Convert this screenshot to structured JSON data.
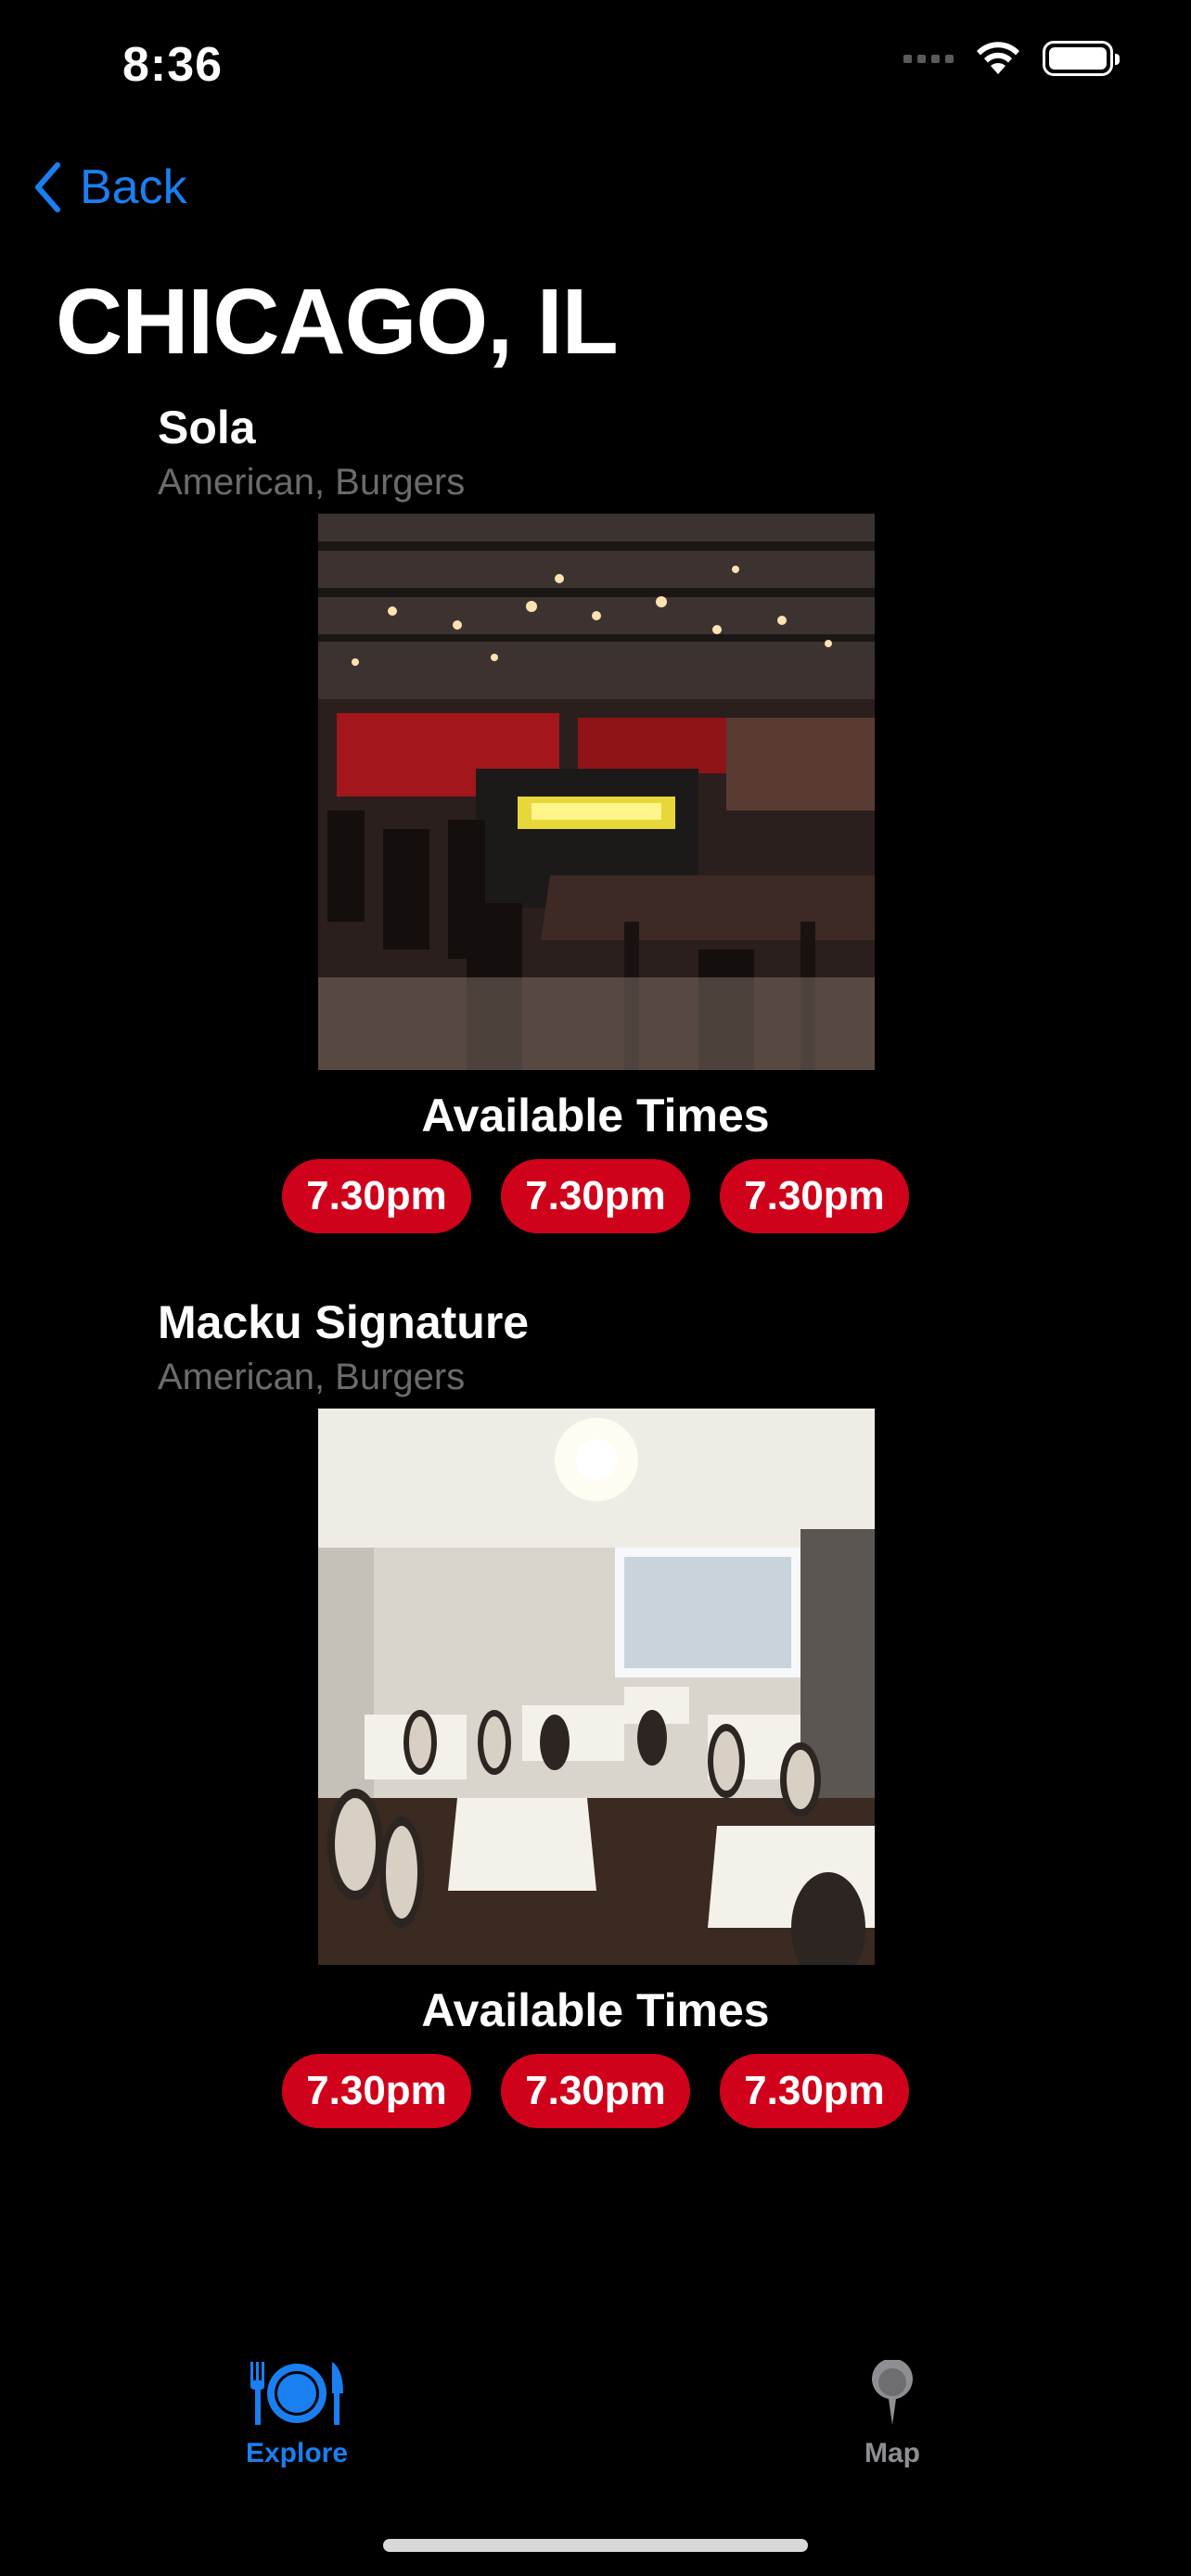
{
  "status_bar": {
    "time": "8:36"
  },
  "nav": {
    "back_label": "Back",
    "title": "CHICAGO, IL"
  },
  "restaurants": [
    {
      "name": "Sola",
      "cuisine": "American, Burgers",
      "times_title": "Available Times",
      "times": [
        "7.30pm",
        "7.30pm",
        "7.30pm"
      ]
    },
    {
      "name": "Macku Signature",
      "cuisine": "American, Burgers",
      "times_title": "Available Times",
      "times": [
        "7.30pm",
        "7.30pm",
        "7.30pm"
      ]
    }
  ],
  "tab_bar": {
    "items": [
      {
        "label": "Explore",
        "icon": "plate-utensils-icon",
        "active": true
      },
      {
        "label": "Map",
        "icon": "map-pin-icon",
        "active": false
      }
    ]
  },
  "colors": {
    "accent": "#1a7ff0",
    "time_chip": "#d0021b",
    "inactive": "#8e8e93",
    "background": "#000000"
  }
}
